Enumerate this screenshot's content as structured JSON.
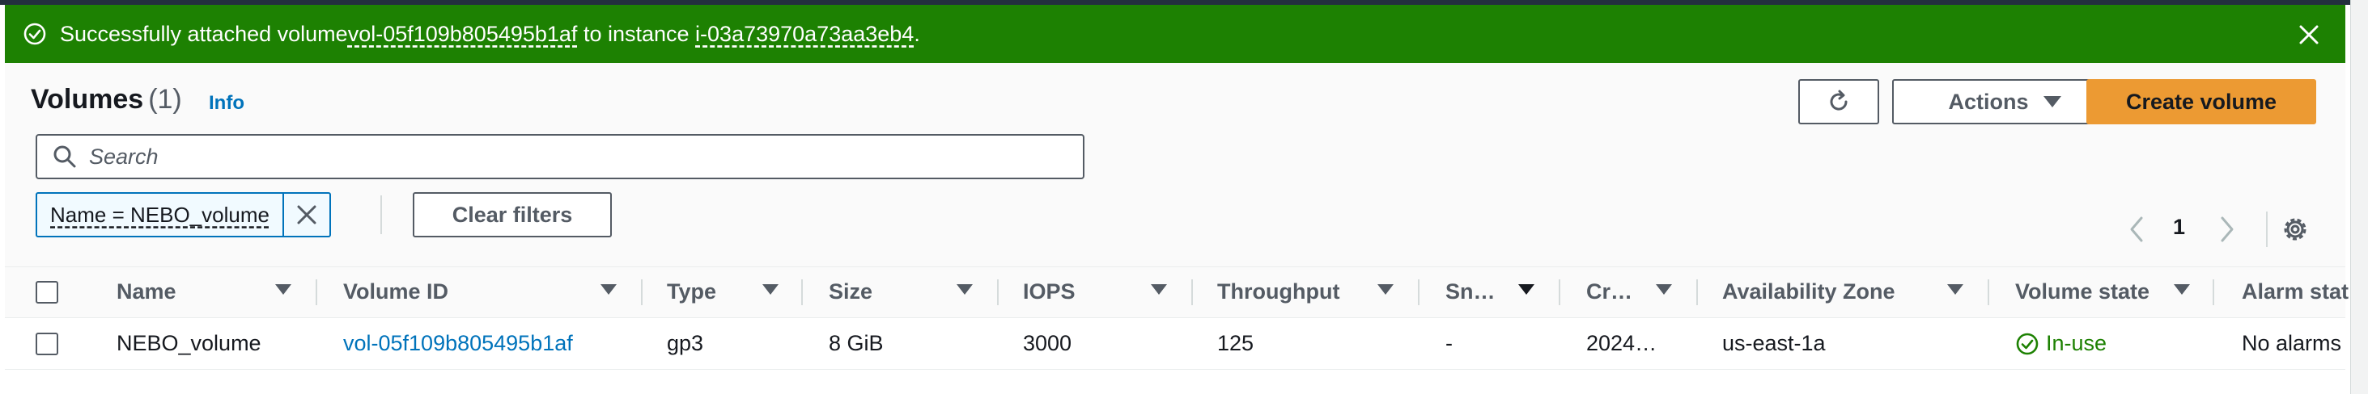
{
  "flash": {
    "prefix": "Successfully attached volume ",
    "volume_link": "vol-05f109b805495b1af",
    "middle": " to instance ",
    "instance_link": "i-03a73970a73aa3eb4",
    "suffix": "."
  },
  "header": {
    "title": "Volumes",
    "count": "(1)",
    "info": "Info",
    "actions_label": "Actions",
    "create_label": "Create volume"
  },
  "search": {
    "placeholder": "Search"
  },
  "filter": {
    "token": "Name = NEBO_volume",
    "clear_label": "Clear filters"
  },
  "pagination": {
    "page": "1"
  },
  "table": {
    "columns": [
      "Name",
      "Volume ID",
      "Type",
      "Size",
      "IOPS",
      "Throughput",
      "Sn…",
      "Cr…",
      "Availability Zone",
      "Volume state",
      "Alarm stat"
    ],
    "rows": [
      {
        "name": "NEBO_volume",
        "volume_id": "vol-05f109b805495b1af",
        "type": "gp3",
        "size": "8 GiB",
        "iops": "3000",
        "throughput": "125",
        "snapshot": "-",
        "created": "2024…",
        "az": "us-east-1a",
        "state": "In-use",
        "alarm": "No alarms"
      }
    ]
  },
  "colors": {
    "success_green": "#1d8102",
    "link_blue": "#0073bb",
    "primary_orange": "#ec9a33"
  }
}
